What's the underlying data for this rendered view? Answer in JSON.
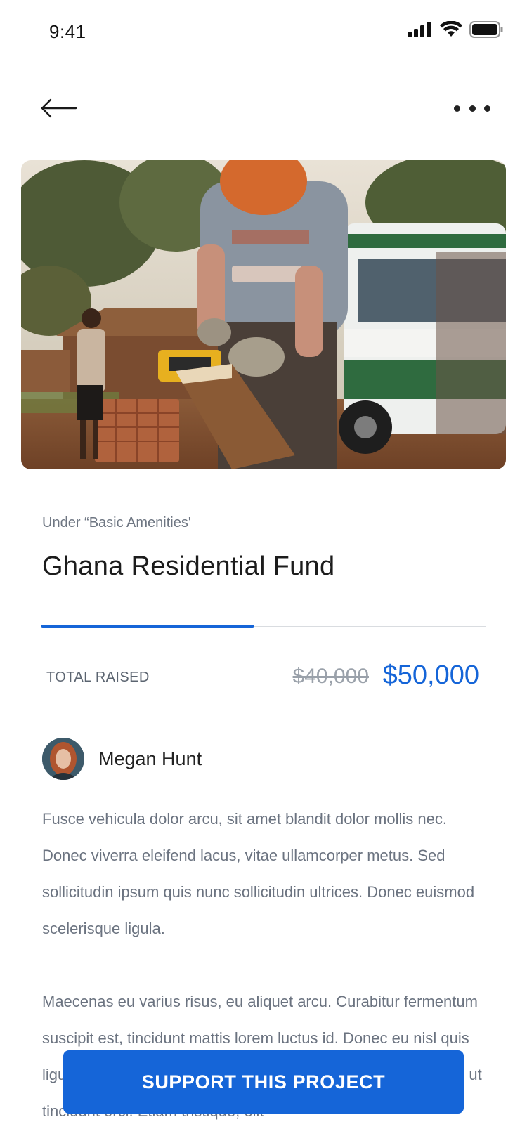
{
  "status_bar": {
    "time": "9:41",
    "icons": [
      "cellular-signal-icon",
      "wifi-icon",
      "battery-icon"
    ]
  },
  "nav": {
    "back_icon": "arrow-left-icon",
    "more_icon": "more-dots-icon"
  },
  "project": {
    "category": "Under “Basic Amenities'",
    "title": "Ghana Residential Fund",
    "progress_fraction": 0.48,
    "raised_label": "TOTAL RAISED",
    "raised_previous": "$40,000",
    "raised_current": "$50,000",
    "author_name": "Megan Hunt",
    "description": [
      "Fusce vehicula dolor arcu, sit amet blandit dolor mollis nec. Donec viverra eleifend lacus, vitae ullamcorper metus. Sed sollicitudin ipsum quis nunc sollicitudin ultrices. Donec euismod scelerisque ligula.",
      "Maecenas eu varius risus, eu aliquet arcu. Curabitur fermentum suscipit est, tincidunt mattis lorem luctus id. Donec eu nisl quis ligula dictum efficitur a sed diam. Nullam erat volutpat. Integer ut tincidunt orci. Etiam tristique, elit"
    ]
  },
  "cta": {
    "label": "SUPPORT THIS PROJECT"
  },
  "colors": {
    "accent": "#1565d8",
    "muted_text": "#6b7380",
    "strike_text": "#9aa1aa"
  }
}
